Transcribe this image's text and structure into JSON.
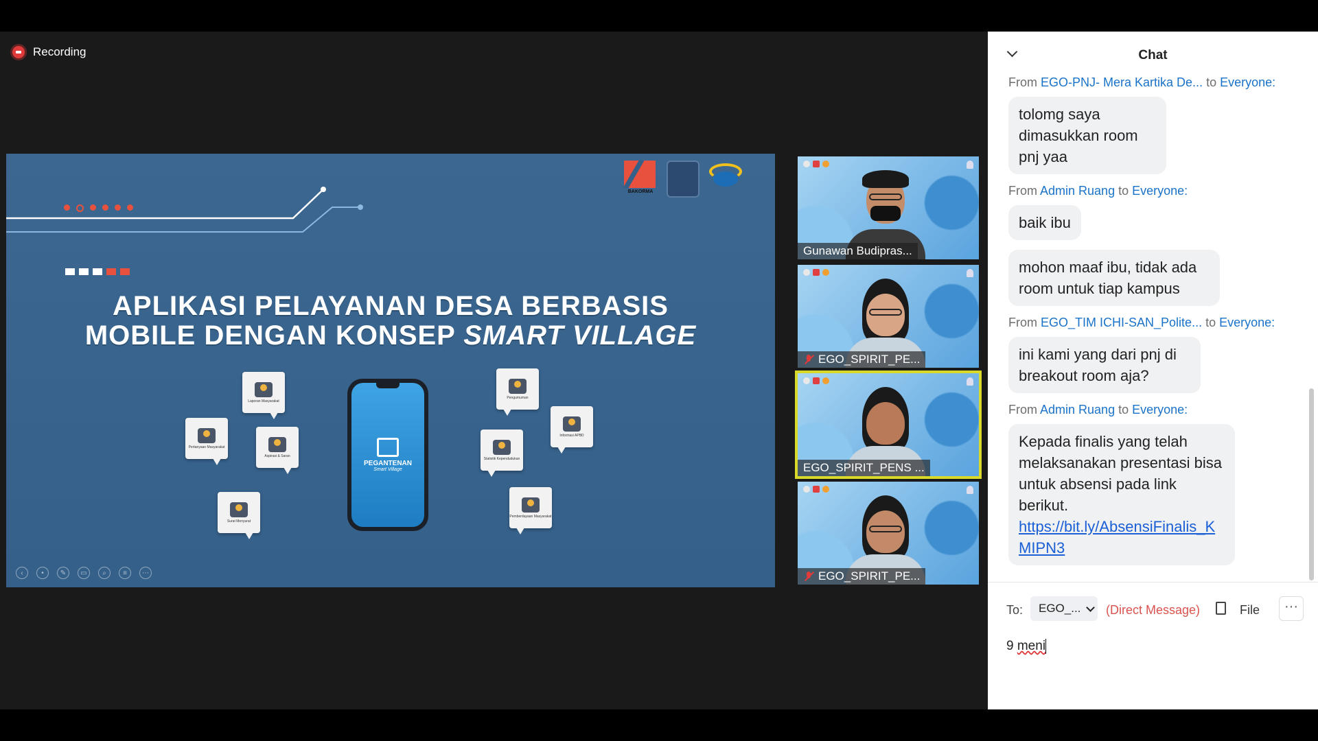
{
  "recording": {
    "label": "Recording"
  },
  "slide": {
    "title_line1": "APLIKASI PELAYANAN DESA BERBASIS",
    "title_line2_prefix": "MOBILE DENGAN KONSEP ",
    "title_line2_italic": "SMART VILLAGE",
    "logo_text": "BAKORMA",
    "app_name": "PEGANTENAN",
    "app_tagline": "Smart Village",
    "features": [
      "Laporan Masyarakat",
      "Pertanyaan Masyarakat",
      "Aspirasi & Saran",
      "Surat Menyurat",
      "Pengumuman",
      "Informasi APBD",
      "Statistik Kependudukan",
      "Pemberdayaan Masyarakat"
    ]
  },
  "participants": [
    {
      "name": "Gunawan Budipras...",
      "muted": false
    },
    {
      "name": "EGO_SPIRIT_PE...",
      "muted": true
    },
    {
      "name": "EGO_SPIRIT_PENS ...",
      "muted": false,
      "active": true
    },
    {
      "name": "EGO_SPIRIT_PE...",
      "muted": true
    }
  ],
  "chat": {
    "title": "Chat",
    "from_label": "From",
    "to_label": "to",
    "messages": [
      {
        "from": "EGO-PNJ- Mera Kartika De...",
        "to": "Everyone:",
        "texts": [
          "tolomg saya dimasukkan room pnj yaa"
        ]
      },
      {
        "from": "Admin Ruang",
        "to": "Everyone:",
        "texts": [
          "baik ibu",
          "mohon maaf ibu, tidak ada room untuk tiap kampus"
        ]
      },
      {
        "from": "EGO_TIM ICHI-SAN_Polite...",
        "to": "Everyone:",
        "texts": [
          "ini kami yang dari pnj di breakout room aja?"
        ]
      },
      {
        "from": "Admin Ruang",
        "to": "Everyone:",
        "texts": [
          "Kepada finalis yang telah melaksanakan presentasi bisa untuk absensi pada link berikut."
        ],
        "link": "https://bit.ly/AbsensiFinalis_KMIPN3"
      }
    ],
    "compose": {
      "to_label": "To:",
      "recipient": "EGO_...",
      "direct_message": "(Direct Message)",
      "file_label": "File",
      "more": "···",
      "draft_prefix": "9 ",
      "draft_word": "meni"
    }
  },
  "colors": {
    "accent_link": "#1a73c9",
    "recording": "#e03a3a",
    "slide_bg": "#3b6791",
    "active_speaker": "#d9d929"
  }
}
